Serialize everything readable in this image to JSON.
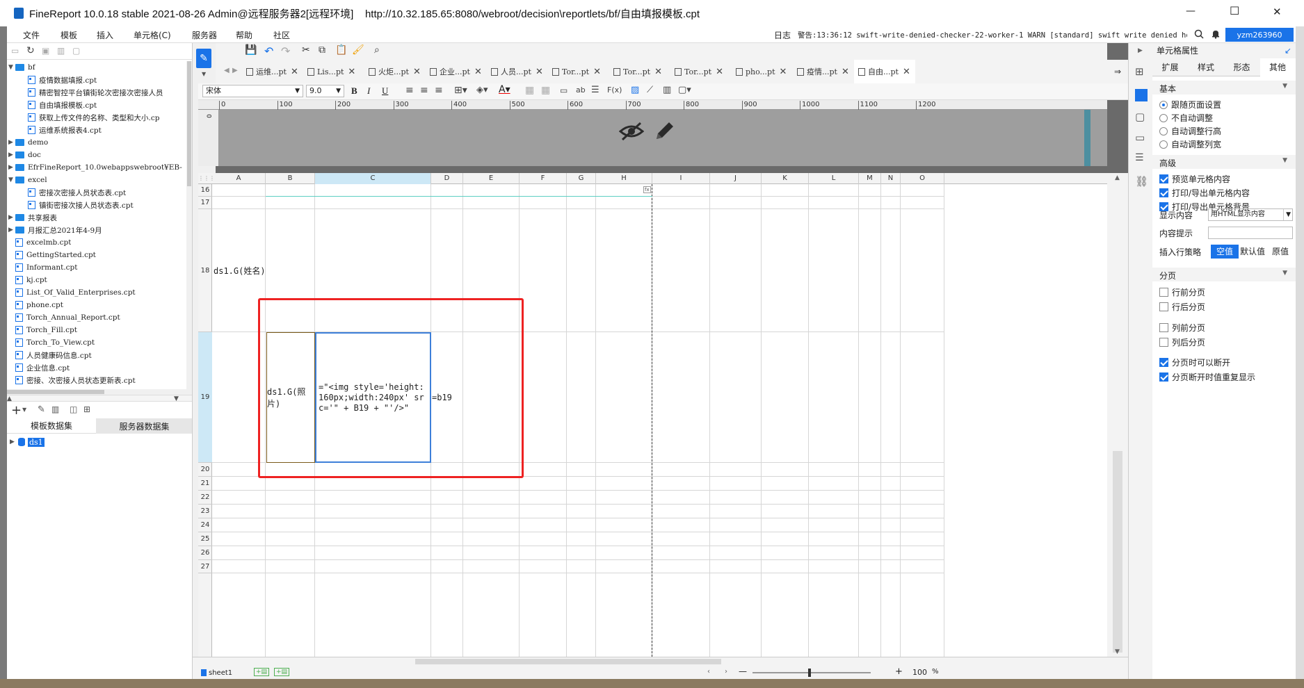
{
  "titlebar": {
    "title": "FineReport 10.0.18 stable 2021-08-26 Admin@远程服务器2[远程环境]    http://10.32.185.65:8080/webroot/decision\\reportlets/bf/自由填报模板.cpt",
    "minimize": "—",
    "maximize": "☐",
    "close": "✕"
  },
  "menubar": {
    "items": [
      "文件",
      "模板",
      "插入",
      "单元格(C)",
      "服务器",
      "帮助",
      "社区"
    ],
    "log_label": "日志",
    "warn_text": "警告:13:36:12 swift-write-denied-checker-22-worker-1 WARN [standard] swift write denied ho...",
    "user": "yzm263960"
  },
  "tree": {
    "items": [
      {
        "label": "bf",
        "kind": "folder",
        "level": 0,
        "open": true
      },
      {
        "label": "疫情数据填报.cpt",
        "kind": "file",
        "level": 2
      },
      {
        "label": "精密智控平台镇街轮次密接次密接人员",
        "kind": "file",
        "level": 2
      },
      {
        "label": "自由填报模板.cpt",
        "kind": "file",
        "level": 2
      },
      {
        "label": "获取上传文件的名称、类型和大小.cp",
        "kind": "file",
        "level": 2
      },
      {
        "label": "运维系统报表4.cpt",
        "kind": "file",
        "level": 2
      },
      {
        "label": "demo",
        "kind": "folder",
        "level": 0,
        "open": false
      },
      {
        "label": "doc",
        "kind": "folder",
        "level": 0,
        "open": false
      },
      {
        "label": "EfrFineReport_10.0webappswebroot¥EB-",
        "kind": "folder",
        "level": 0,
        "open": false
      },
      {
        "label": "excel",
        "kind": "folder",
        "level": 0,
        "open": true
      },
      {
        "label": "密接次密接人员状态表.cpt",
        "kind": "file",
        "level": 2
      },
      {
        "label": "镇街密接次接人员状态表.cpt",
        "kind": "file",
        "level": 2
      },
      {
        "label": "共享报表",
        "kind": "folder",
        "level": 0,
        "open": false
      },
      {
        "label": "月报汇总2021年4-9月",
        "kind": "folder",
        "level": 0,
        "open": false
      },
      {
        "label": "excelmb.cpt",
        "kind": "file",
        "level": 1
      },
      {
        "label": "GettingStarted.cpt",
        "kind": "file",
        "level": 1
      },
      {
        "label": "Informant.cpt",
        "kind": "file",
        "level": 1
      },
      {
        "label": "kj.cpt",
        "kind": "file",
        "level": 1
      },
      {
        "label": "List_Of_Valid_Enterprises.cpt",
        "kind": "file",
        "level": 1
      },
      {
        "label": "phone.cpt",
        "kind": "file",
        "level": 1
      },
      {
        "label": "Torch_Annual_Report.cpt",
        "kind": "file",
        "level": 1
      },
      {
        "label": "Torch_Fill.cpt",
        "kind": "file",
        "level": 1
      },
      {
        "label": "Torch_To_View.cpt",
        "kind": "file",
        "level": 1
      },
      {
        "label": "人员健康码信息.cpt",
        "kind": "file",
        "level": 1
      },
      {
        "label": "企业信息.cpt",
        "kind": "file",
        "level": 1
      },
      {
        "label": "密接、次密接人员状态更新表.cpt",
        "kind": "file",
        "level": 1
      }
    ]
  },
  "dataset_panel": {
    "tabs": [
      "模板数据集",
      "服务器数据集"
    ],
    "items": [
      "ds1"
    ]
  },
  "editor_tabs": [
    "运维...pt",
    "Lis...pt",
    "火炬...pt",
    "企业...pt",
    "人员...pt",
    "Tor...pt",
    "Tor...pt",
    "Tor...pt",
    "pho...pt",
    "疫情...pt",
    "自由...pt"
  ],
  "format_toolbar": {
    "font": "宋体",
    "size": "9.0"
  },
  "ruler": {
    "ticks": [
      "0",
      "100",
      "200",
      "300",
      "400",
      "500",
      "600",
      "700",
      "800",
      "900",
      "1000",
      "1100",
      "1200"
    ]
  },
  "grid": {
    "columns": [
      "A",
      "B",
      "C",
      "D",
      "E",
      "F",
      "G",
      "H",
      "I",
      "J",
      "K",
      "L",
      "M",
      "N",
      "O"
    ],
    "rows": [
      "16",
      "17",
      "18",
      "19",
      "20",
      "21",
      "22",
      "23",
      "24",
      "25",
      "26",
      "27"
    ],
    "cells": {
      "a18": "ds1.G(姓名)",
      "b19": "ds1.G(照片)",
      "c19": "=\"<img style='height:160px;width:240px' src='\" + B19 + \"'/>\"",
      "d19": "=b19"
    }
  },
  "statusbar": {
    "sheet": "sheet1",
    "zoom": "100",
    "pct": "%",
    "minus": "—",
    "plus": "+"
  },
  "props": {
    "header": "单元格属性",
    "tabs": [
      "扩展",
      "样式",
      "形态",
      "其他"
    ],
    "basic_title": "基本",
    "basic_options": [
      {
        "label": "跟随页面设置",
        "checked": true
      },
      {
        "label": "不自动调整",
        "checked": false
      },
      {
        "label": "自动调整行高",
        "checked": false
      },
      {
        "label": "自动调整列宽",
        "checked": false
      }
    ],
    "advanced_title": "高级",
    "advanced_options": [
      {
        "label": "预览单元格内容",
        "checked": true
      },
      {
        "label": "打印/导出单元格内容",
        "checked": true
      },
      {
        "label": "打印/导出单元格背景",
        "checked": true
      }
    ],
    "display_label": "显示内容",
    "display_value": "用HTML显示内容",
    "hint_label": "内容提示",
    "hint_value": "",
    "insert_label": "插入行策略",
    "insert_options": [
      "空值",
      "默认值",
      "原值"
    ],
    "paging_title": "分页",
    "paging_options": [
      {
        "label": "行前分页",
        "checked": false
      },
      {
        "label": "行后分页",
        "checked": false
      },
      {
        "label": "列前分页",
        "checked": false
      },
      {
        "label": "列后分页",
        "checked": false
      },
      {
        "label": "分页时可以断开",
        "checked": true
      },
      {
        "label": "分页断开时值重复显示",
        "checked": true
      }
    ]
  },
  "colors": {
    "accent": "#1a73e8",
    "selection_red": "#ee2222",
    "selected_hdr": "#cde8f6"
  }
}
